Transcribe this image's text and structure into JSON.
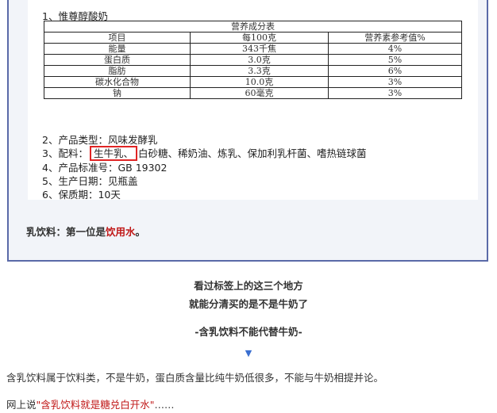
{
  "label": {
    "title": "1、惟尊醇酸奶",
    "table": {
      "caption": "营养成分表",
      "headers": [
        "项目",
        "每100克",
        "营养素参考值%"
      ],
      "rows": [
        [
          "能量",
          "343千焦",
          "4%"
        ],
        [
          "蛋白质",
          "3.0克",
          "5%"
        ],
        [
          "脂肪",
          "3.3克",
          "6%"
        ],
        [
          "碳水化合物",
          "10.0克",
          "3%"
        ],
        [
          "钠",
          "60毫克",
          "3%"
        ]
      ]
    },
    "type_line": "2、产品类型：风味发酵乳",
    "ingredients_prefix": "3、配料：",
    "ingredients_highlight": "生牛乳、",
    "ingredients_rest": "白砂糖、稀奶油、炼乳、保加利乳杆菌、嗜热链球菌",
    "standard_line": "4、产品标准号：GB 19302",
    "date_line": "5、生产日期：见瓶盖",
    "shelf_line": "6、保质期：10天"
  },
  "panel_caption": {
    "prefix": "乳饮料：第一位是",
    "highlight": "饮用水",
    "suffix": "。"
  },
  "article": {
    "line1": "看过标签上的这三个地方",
    "line2": "就能分清买的是不是牛奶了",
    "subheading": "-含乳饮料不能代替牛奶-",
    "arrow": "▼",
    "para1": "含乳饮料属于饮料类，不是牛奶，蛋白质含量比纯牛奶低很多，不能与牛奶相提并论。",
    "para2_prefix": "网上说",
    "para2_highlight": "\"含乳饮料就是糖兑白开水\"",
    "para2_suffix": "……"
  },
  "colors": {
    "highlight_red": "#c01818",
    "box_red": "#e02424",
    "panel_border": "#5a6aa8",
    "arrow_blue": "#3a6fd0"
  }
}
